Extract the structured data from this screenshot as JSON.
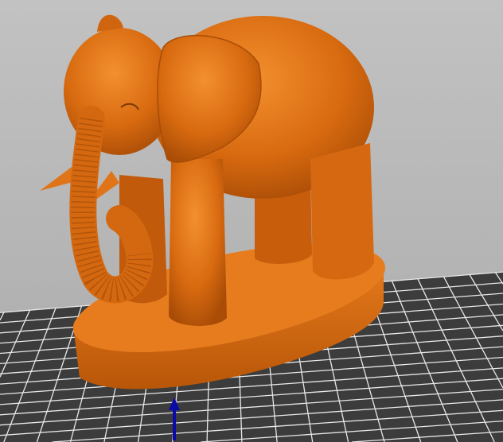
{
  "viewport": {
    "background_color": "#b8b8b8",
    "bed": {
      "plate_color": "#3c3c3c",
      "grid_line_color": "#e8e8e8",
      "grid_divisions": 24
    },
    "model": {
      "name_semantic": "elephant-model",
      "color": "#d86a10",
      "highlight_color": "#f08a2a",
      "shadow_color": "#a04a05"
    },
    "axis": {
      "name_semantic": "z-axis-arrow-icon",
      "color": "#0a0aa8"
    }
  }
}
